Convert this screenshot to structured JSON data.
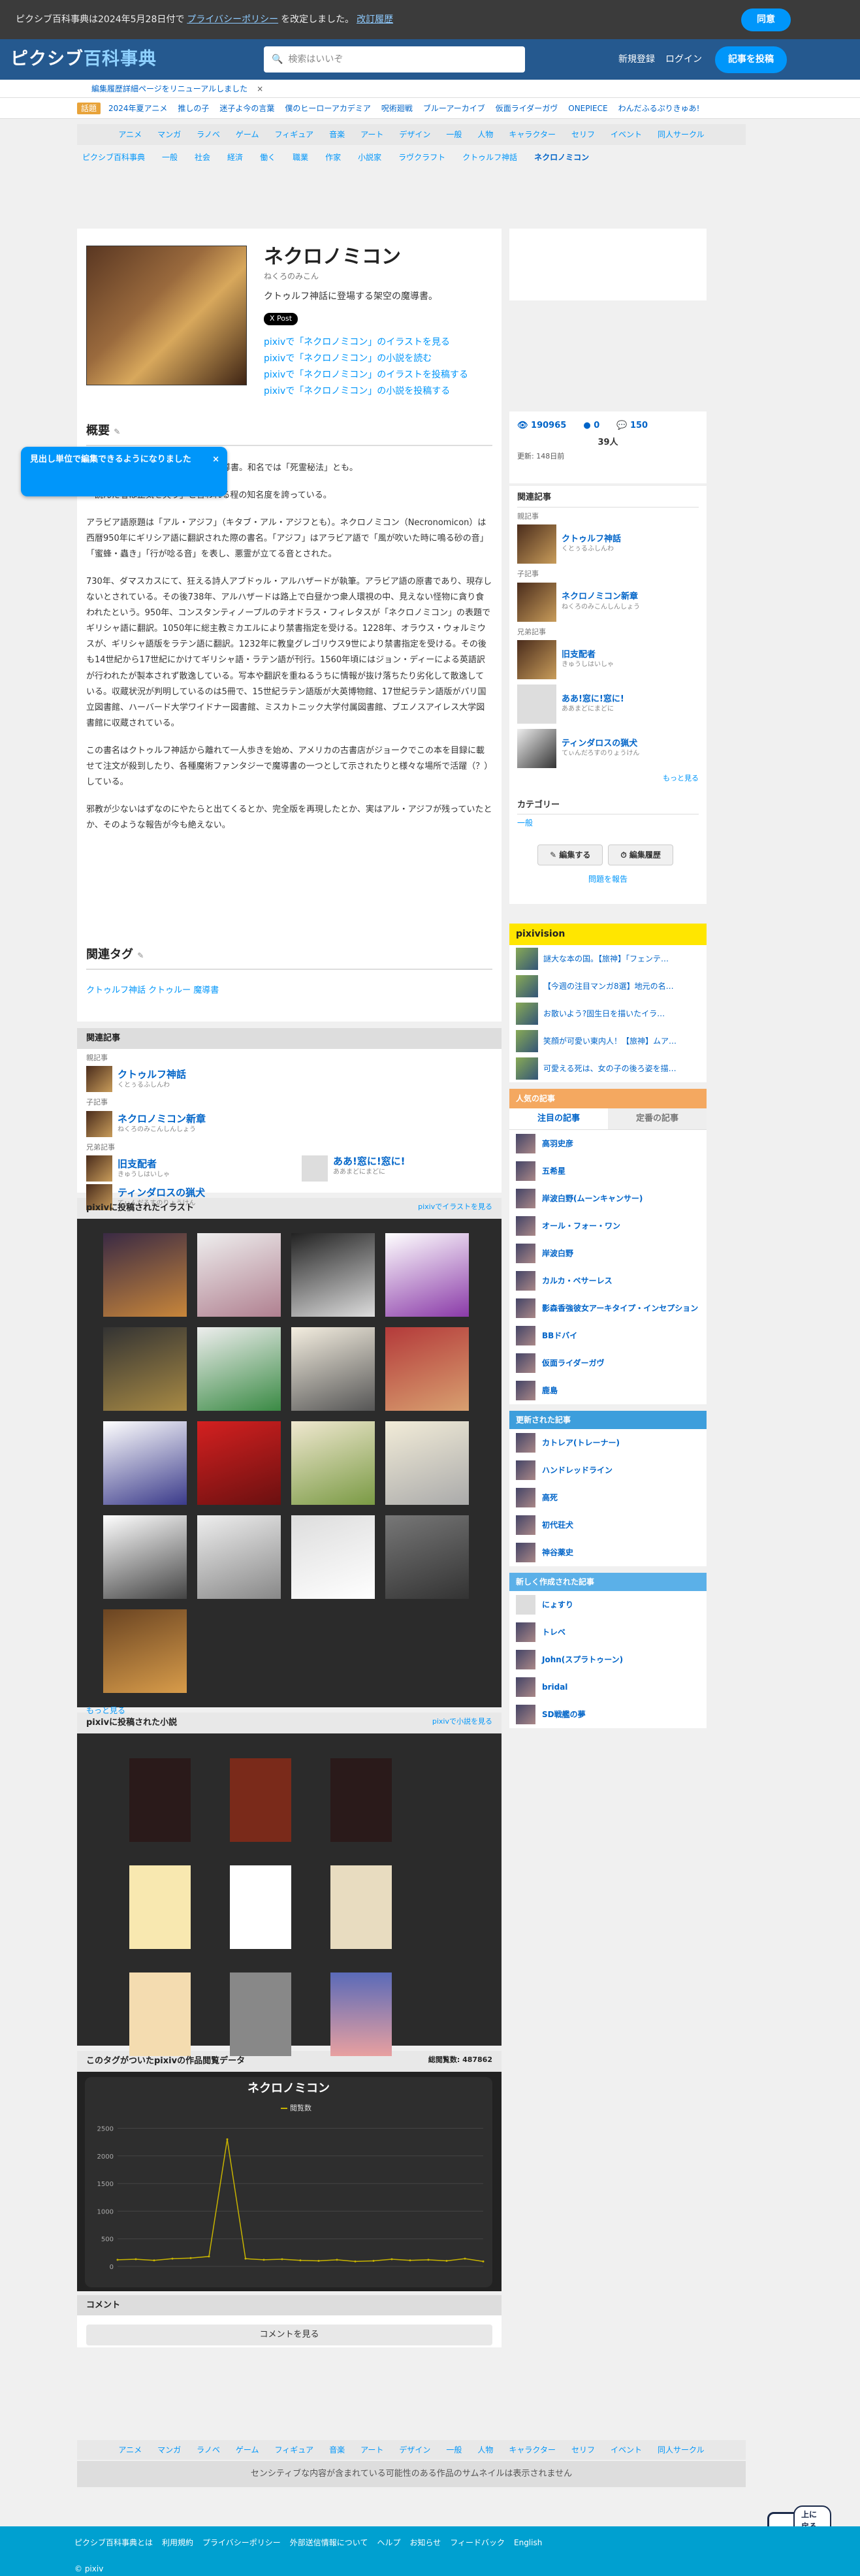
{
  "topbar": {
    "text": "ピクシブ百科事典は2024年5月28日付で",
    "link1": "プライバシーポリシー",
    "text2": "を改定しました。",
    "link2": "改訂履歴",
    "agree": "同意"
  },
  "header": {
    "logo_a": "ピクシブ",
    "logo_b": "百科事典",
    "search_placeholder": "検索はいいぞ",
    "signup": "新規登録",
    "login": "ログイン",
    "post": "記事を投稿"
  },
  "notice": {
    "text": "編集履歴詳細ページをリニューアルしました",
    "close": "×"
  },
  "pills": {
    "badge": "話題",
    "items": [
      "2024年夏アニメ",
      "推しの子",
      "迷子よ今の言葉",
      "僕のヒーローアカデミア",
      "呪術廻戦",
      "ブルーアーカイブ",
      "仮面ライダーガヴ",
      "ONEPIECE",
      "わんだふるぷりきゅあ!"
    ]
  },
  "nav": [
    "アニメ",
    "マンガ",
    "ラノベ",
    "ゲーム",
    "フィギュア",
    "音楽",
    "アート",
    "デザイン",
    "一般",
    "人物",
    "キャラクター",
    "セリフ",
    "イベント",
    "同人サークル"
  ],
  "breadcrumb": [
    "ピクシブ百科事典",
    "一般",
    "社会",
    "経済",
    "働く",
    "職業",
    "作家",
    "小説家",
    "ラヴクラフト",
    "クトゥルフ神話",
    "ネクロノミコン"
  ],
  "hero": {
    "title": "ネクロノミコン",
    "kana": "ねくろのみこん",
    "desc": "クトゥルフ神話に登場する架空の魔導書。",
    "x_post": "X Post",
    "links": [
      "pixivで「ネクロノミコン」のイラストを見る",
      "pixivで「ネクロノミコン」の小説を読む",
      "pixivで「ネクロノミコン」のイラストを投稿する",
      "pixivで「ネクロノミコン」の小説を投稿する"
    ]
  },
  "tooltip": {
    "text": "見出し単位で編集できるようになりました",
    "close": "×"
  },
  "article": {
    "heading": "概要",
    "paragraphs": [
      "クトゥルフ神話に登場する架空の魔導書。和名では「死霊秘法」とも。",
      "「読んだ者は正気を失う」と言われる程の知名度を誇っている。",
      "アラビア語原題は「アル・アジフ」（キタブ・アル・アジフとも）。ネクロノミコン（Necronomicon）は西暦950年にギリシア語に翻訳された際の書名。「アジフ」はアラビア語で「風が吹いた時に鳴る砂の音」「蜜蜂・蟲き」「行が唸る音」を表し、悪霊が立てる音とされた。",
      "730年、ダマスカスにて、狂える詩人アブドゥル・アルハザードが執筆。アラビア語の原書であり、現存しないとされている。その後738年、アルハザードは路上で白昼かつ衆人環視の中、見えない怪物に貪り食われたという。950年、コンスタンティノープルのテオドラス・フィレタスが「ネクロノミコン」の表題でギリシャ語に翻訳。1050年に総主教ミカエルにより禁書指定を受ける。1228年、オラウス・ウォルミウスが、ギリシャ語版をラテン語に翻訳。1232年に教皇グレゴリウス9世により禁書指定を受ける。その後も14世紀から17世紀にかけてギリシャ語・ラテン語が刊行。1560年頃にはジョン・ディーによる英語訳が行われたが製本されず散逸している。写本や翻訳を重ねるうちに情報が抜け落ちたり劣化して散逸している。収蔵状況が判明しているのは5冊で、15世紀ラテン語版が大英博物館、17世紀ラテン語版がパリ国立図書館、ハーバード大学ワイドナー図書館、ミスカトニック大学付属図書館、ブエノスアイレス大学図書館に収蔵されている。",
      "この書名はクトゥルフ神話から離れて一人歩きを始め、アメリカの古書店がジョークでこの本を目録に載せて注文が殺到したり、各種魔術ファンタジーで魔導書の一つとして示されたりと様々な場所で活躍（？）している。",
      "邪教が少ないはずなのにやたらと出てくるとか、完全版を再現したとか、実はアル・アジフが残っていたとか、そのような報告が今も絶えない。"
    ]
  },
  "tags": {
    "heading": "関連タグ",
    "list": "クトゥルフ神話 クトゥルー 魔導書"
  },
  "related": {
    "heading": "関連記事",
    "parent_label": "親記事",
    "parent": {
      "name": "クトゥルフ神話",
      "kana": "くとぅるふしんわ"
    },
    "child_label": "子記事",
    "child": {
      "name": "ネクロノミコン新章",
      "kana": "ねくろのみこんしんしょう"
    },
    "sibling_label": "兄弟記事",
    "siblings": [
      {
        "name": "旧支配者",
        "kana": "きゅうしはいしゃ"
      },
      {
        "name": "ティンダロスの猟犬",
        "kana": "てぃんだろすのりょうけん"
      },
      {
        "name": "ああ!窓に!窓に!",
        "kana": "ああまどにまどに"
      }
    ]
  },
  "illust": {
    "heading": "pixivに投稿されたイラスト",
    "more": "pixivでイラストを見る",
    "more_below": "もっと見る"
  },
  "novels": {
    "heading": "pixivに投稿された小説",
    "more": "pixivで小説を見る"
  },
  "views": {
    "heading": "このタグがついたpixivの作品閲覧データ",
    "total": "総閲覧数: 487862",
    "chart_title": "ネクロノミコン",
    "legend": "閲覧数"
  },
  "chart_data": {
    "type": "line",
    "title": "ネクロノミコン",
    "series": [
      {
        "name": "閲覧数",
        "values": [
          120,
          130,
          110,
          140,
          150,
          180,
          2300,
          140,
          120,
          130,
          110,
          100,
          120,
          90,
          100,
          130,
          110,
          120,
          100,
          140,
          90
        ]
      }
    ],
    "yticks": [
      "0",
      "500",
      "1000",
      "1500",
      "2000",
      "2500"
    ],
    "ylim": [
      0,
      2600
    ]
  },
  "comment": {
    "heading": "コメント",
    "button": "コメントを見る"
  },
  "side": {
    "views": "190965",
    "comments": "0",
    "likes": "150",
    "people": "39人",
    "updated": "更新: 148日前",
    "related_heading": "関連記事",
    "category_heading": "カテゴリー",
    "category": "一般",
    "edit": "編集する",
    "history": "編集履歴",
    "report": "問題を報告",
    "more": "もっと見る"
  },
  "pixivision": {
    "heading": "pixivision",
    "items": [
      "謎大な本の国。【旅神】「フェンテ…",
      "【今週の注目マンガ8選】地元の名…",
      "お散いよう?固生日を描いたイラ…",
      "笑顔が可愛い東内人！【旅神】ムア…",
      "可愛える死は、女の子の後ろ姿を描…"
    ]
  },
  "popular": {
    "heading": "人気の記事",
    "tab1": "注目の記事",
    "tab2": "定番の記事",
    "items": [
      "高羽史彦",
      "五希星",
      "岸波白野(ムーンキャンサー)",
      "オール・フォー・ワン",
      "岸波白野",
      "カルカ・ベサーレス",
      "影森香強彼女アーキタイプ・インセプション",
      "BBドバイ",
      "仮面ライダーガヴ",
      "鹿島"
    ]
  },
  "updated": {
    "heading": "更新された記事",
    "items": [
      "カトレア(トレーナー)",
      "ハンドレッドライン",
      "高死",
      "初代荘犬",
      "神谷薬史"
    ]
  },
  "newart": {
    "heading": "新しく作成された記事",
    "items": [
      "にょすり",
      "トレベ",
      "John(スプラトゥーン)",
      "bridal",
      "SD戦艦の夢"
    ]
  },
  "footnav": [
    "アニメ",
    "マンガ",
    "ラノベ",
    "ゲーム",
    "フィギュア",
    "音楽",
    "アート",
    "デザイン",
    "一般",
    "人物",
    "キャラクター",
    "セリフ",
    "イベント",
    "同人サークル"
  ],
  "sensitive": "センシティブな内容が含まれている可能性のある作品のサムネイルは表示されません",
  "footer": {
    "links": [
      "ピクシブ百科事典とは",
      "利用規約",
      "プライバシーポリシー",
      "外部送信情報について",
      "ヘルプ",
      "お知らせ",
      "フィードバック",
      "English"
    ],
    "copyright": "© pixiv",
    "top": "上に戻る"
  }
}
